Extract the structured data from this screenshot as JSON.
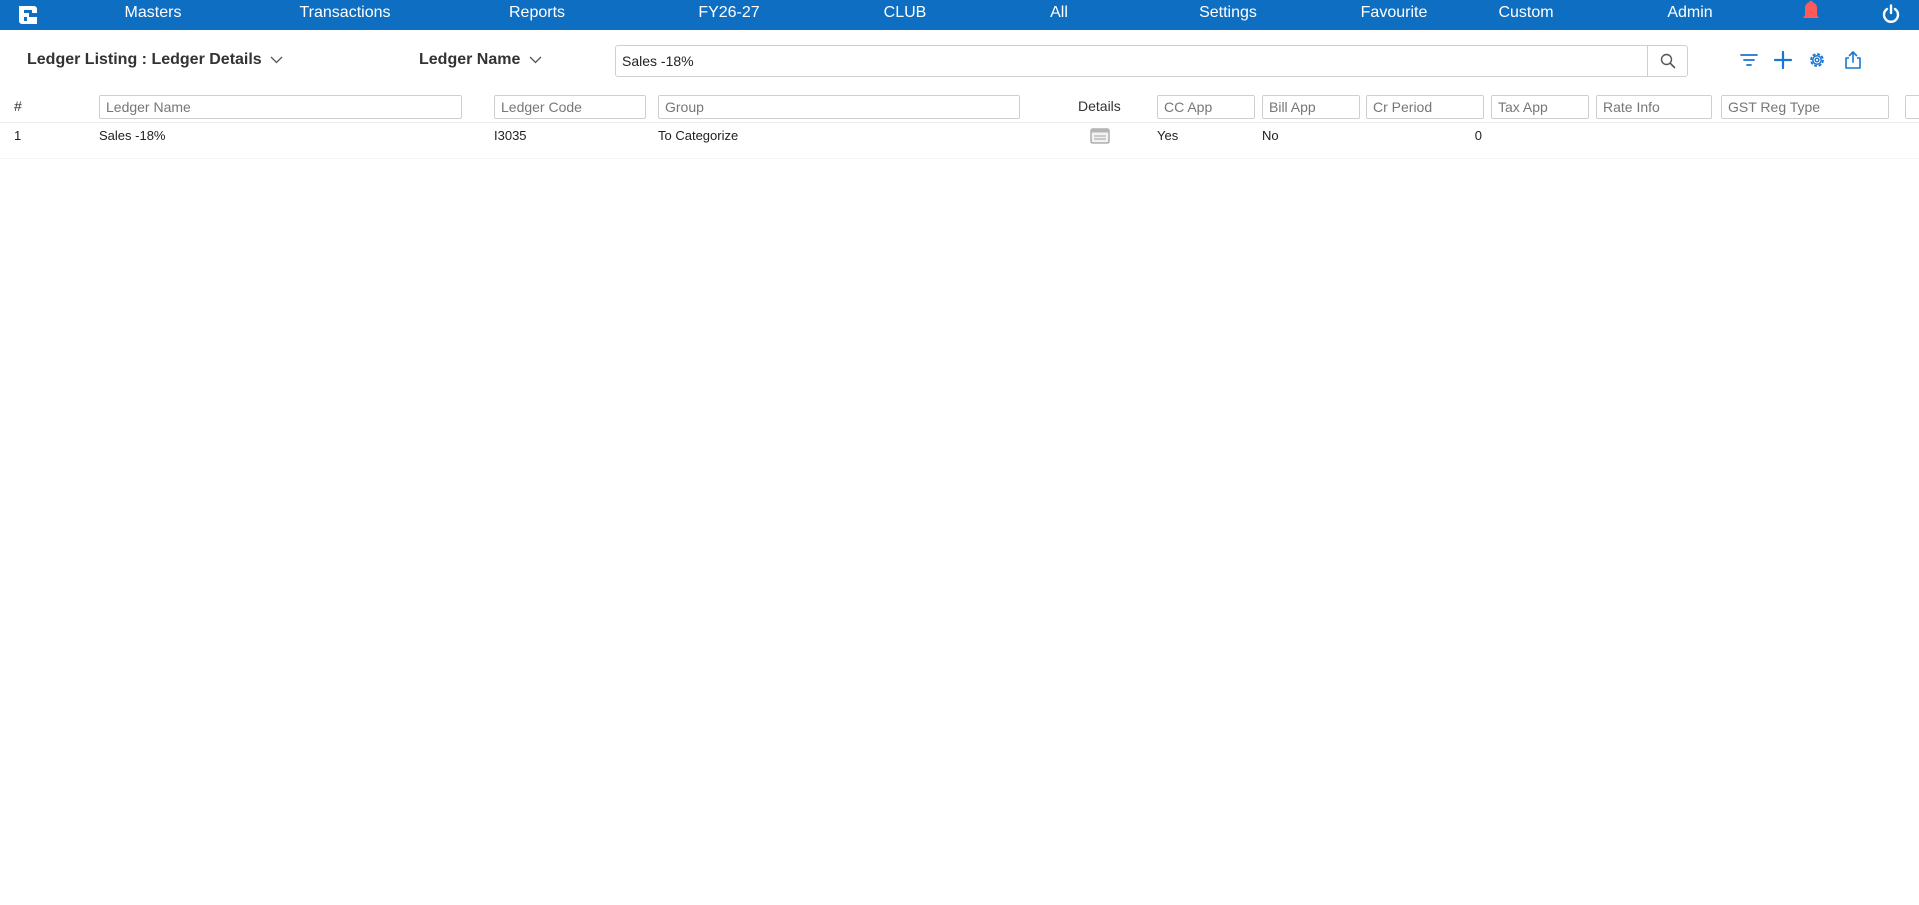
{
  "nav": {
    "items": [
      "Masters",
      "Transactions",
      "Reports",
      "FY26-27",
      "CLUB",
      "All",
      "Settings",
      "Favourite",
      "Custom",
      "Admin"
    ]
  },
  "toolbar": {
    "title": "Ledger Listing : Ledger Details",
    "search_field": "Ledger Name",
    "search_value": "Sales -18%"
  },
  "table": {
    "hash_header": "#",
    "details_header": "Details",
    "filters": {
      "ledger_name": "Ledger Name",
      "ledger_code": "Ledger Code",
      "group": "Group",
      "cc_app": "CC App",
      "bill_app": "Bill App",
      "cr_period": "Cr Period",
      "tax_app": "Tax App",
      "rate_info": "Rate Info",
      "gst_reg_type": "GST Reg Type"
    },
    "rows": [
      {
        "index": "1",
        "ledger_name": "Sales -18%",
        "ledger_code": "I3035",
        "group": "To Categorize",
        "cc_app": "Yes",
        "bill_app": "No",
        "cr_period": "0"
      }
    ]
  },
  "colors": {
    "nav_bg": "#0e6ec1",
    "accent": "#1976d2",
    "bell": "#ff5a5a"
  },
  "icons": [
    "app-logo-icon",
    "bell-icon",
    "power-icon",
    "chevron-down-icon",
    "search-icon",
    "filter-icon",
    "plus-icon",
    "gear-icon",
    "export-icon",
    "details-card-icon"
  ]
}
